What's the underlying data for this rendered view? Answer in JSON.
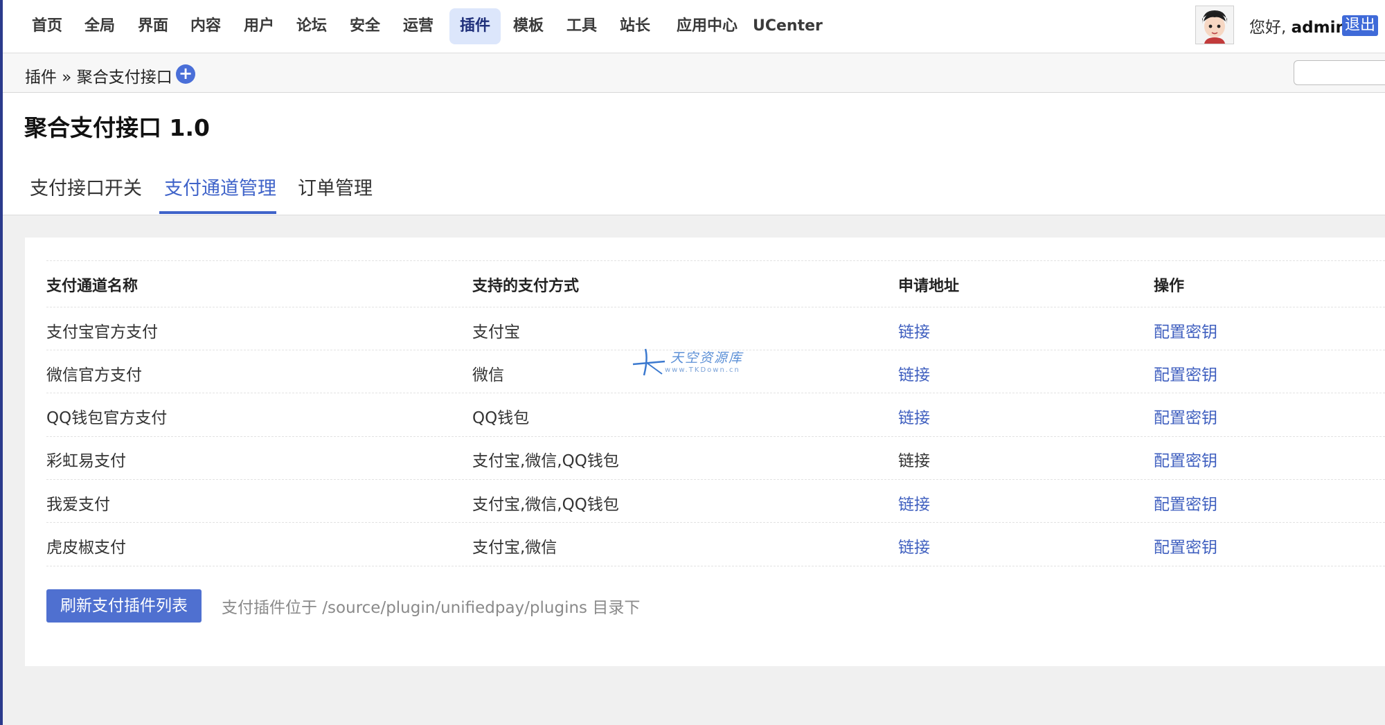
{
  "nav": {
    "items": [
      "首页",
      "全局",
      "界面",
      "内容",
      "用户",
      "论坛",
      "安全",
      "运营",
      "插件",
      "模板",
      "工具",
      "站长",
      "应用中心",
      "UCenter"
    ],
    "active": "插件"
  },
  "user": {
    "greeting": "您好, ",
    "name": "admin",
    "logout": "退出"
  },
  "breadcrumb": "插件 » 聚合支付接口",
  "page": {
    "title": "聚合支付接口 1.0"
  },
  "tabs": [
    "支付接口开关",
    "支付通道管理",
    "订单管理"
  ],
  "active_tab": "支付通道管理",
  "table": {
    "headers": [
      "支付通道名称",
      "支持的支付方式",
      "申请地址",
      "操作"
    ],
    "rows": [
      {
        "name": "支付宝官方支付",
        "methods": "支付宝",
        "link": "链接",
        "action": "配置密钥"
      },
      {
        "name": "微信官方支付",
        "methods": "微信",
        "link": "链接",
        "action": "配置密钥"
      },
      {
        "name": "QQ钱包官方支付",
        "methods": "QQ钱包",
        "link": "链接",
        "action": "配置密钥"
      },
      {
        "name": "彩虹易支付",
        "methods": "支付宝,微信,QQ钱包",
        "link": "链接",
        "action": "配置密钥"
      },
      {
        "name": "我爱支付",
        "methods": "支付宝,微信,QQ钱包",
        "link": "链接",
        "action": "配置密钥"
      },
      {
        "name": "虎皮椒支付",
        "methods": "支付宝,微信",
        "link": "链接",
        "action": "配置密钥"
      }
    ]
  },
  "refresh_button": "刷新支付插件列表",
  "hint": "支付插件位于 /source/plugin/unifiedpay/plugins 目录下",
  "watermark": {
    "cn": "天空资源库",
    "en": "www.TKDown.cn"
  },
  "colors": {
    "accent": "#3f63c9",
    "link": "#3f5fbf",
    "button": "#4f70d0"
  }
}
